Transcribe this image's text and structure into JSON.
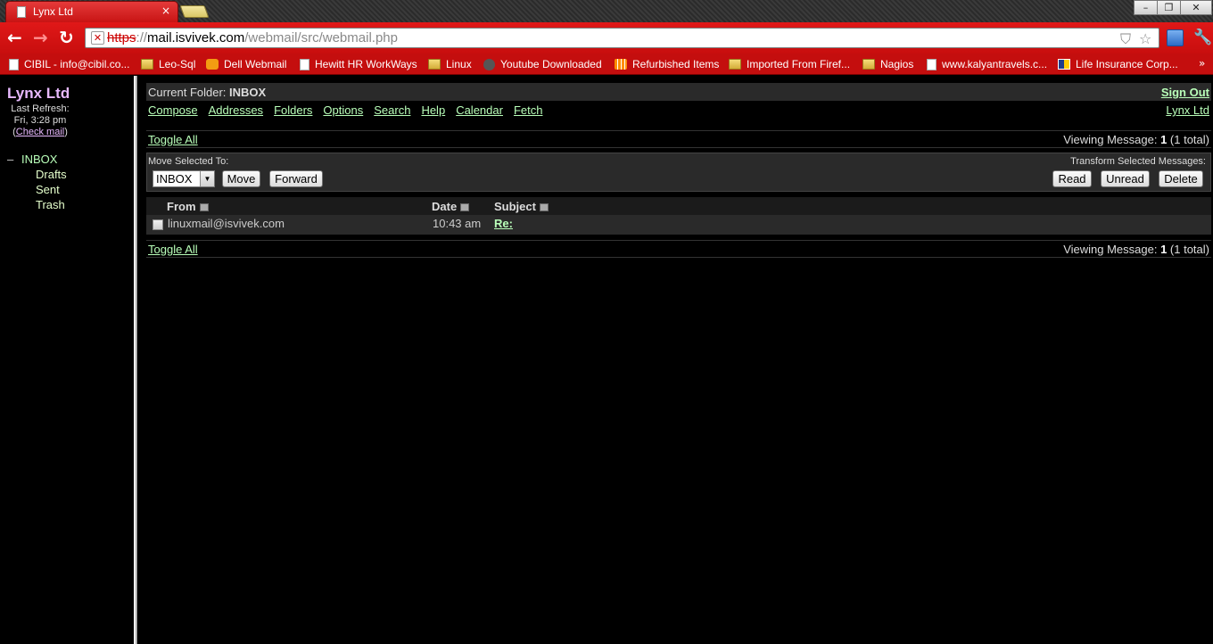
{
  "browser": {
    "tab_title": "Lynx Ltd",
    "url_scheme": "https",
    "url_sep": "://",
    "url_host": "mail.isvivek.com",
    "url_path": "/webmail/src/webmail.php",
    "bookmarks": [
      {
        "label": "CIBIL - info@cibil.co...",
        "icon": "page"
      },
      {
        "label": "Leo-Sql",
        "icon": "folder"
      },
      {
        "label": "Dell Webmail",
        "icon": "orange"
      },
      {
        "label": "Hewitt HR WorkWays",
        "icon": "page"
      },
      {
        "label": "Linux",
        "icon": "folder"
      },
      {
        "label": "Youtube Downloaded",
        "icon": "circle"
      },
      {
        "label": "Refurbished Items",
        "icon": "grid"
      },
      {
        "label": "Imported From Firef...",
        "icon": "folder"
      },
      {
        "label": "Nagios",
        "icon": "folder"
      },
      {
        "label": "www.kalyantravels.c...",
        "icon": "page"
      },
      {
        "label": "Life Insurance Corp...",
        "icon": "lic"
      }
    ],
    "bookmarks_more": "»"
  },
  "left": {
    "org_name": "Lynx Ltd",
    "last_refresh_label": "Last Refresh:",
    "last_refresh_time": "Fri, 3:28 pm",
    "check_mail_open": "(",
    "check_mail": "Check mail",
    "check_mail_close": ")",
    "folders": [
      {
        "toggle": "–",
        "label": "INBOX"
      },
      {
        "label": "Drafts"
      },
      {
        "label": "Sent"
      },
      {
        "label": "Trash"
      }
    ]
  },
  "main": {
    "current_folder_label": "Current Folder: ",
    "current_folder": "INBOX",
    "sign_out": "Sign Out",
    "menu": [
      "Compose",
      "Addresses",
      "Folders",
      "Options",
      "Search",
      "Help",
      "Calendar",
      "Fetch"
    ],
    "org_link": "Lynx Ltd",
    "toggle_all": "Toggle All",
    "viewing_label": "Viewing Message: ",
    "viewing_num": "1",
    "viewing_total": " (1 total)",
    "move_selected_label": "Move Selected To:",
    "transform_label": "Transform Selected Messages:",
    "move_select_value": "INBOX",
    "buttons": {
      "move": "Move",
      "forward": "Forward",
      "read": "Read",
      "unread": "Unread",
      "delete": "Delete"
    },
    "columns": {
      "from": "From",
      "date": "Date",
      "subject": "Subject"
    },
    "messages": [
      {
        "from": "linuxmail@isvivek.com",
        "date": "10:43 am",
        "subject": "Re:"
      }
    ]
  },
  "colors": {
    "link": "#b9ffb9",
    "org": "#e8b9ff",
    "chrome_red": "#c80e0e"
  }
}
